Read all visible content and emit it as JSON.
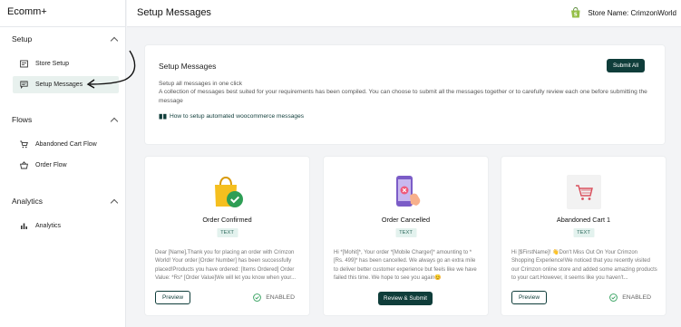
{
  "app": {
    "brand": "Ecomm+"
  },
  "header": {
    "title": "Setup Messages",
    "store_label": "Store Name: CrimzonWorld"
  },
  "sidebar": {
    "sections": [
      {
        "title": "Setup",
        "items": [
          {
            "label": "Store Setup",
            "icon": "store-icon"
          },
          {
            "label": "Setup Messages",
            "icon": "message-icon",
            "active": true
          }
        ]
      },
      {
        "title": "Flows",
        "items": [
          {
            "label": "Abandoned Cart Flow",
            "icon": "cart-icon"
          },
          {
            "label": "Order Flow",
            "icon": "basket-icon"
          }
        ]
      },
      {
        "title": "Analytics",
        "items": [
          {
            "label": "Analytics",
            "icon": "bar-chart-icon"
          }
        ]
      }
    ]
  },
  "setup": {
    "title": "Setup Messages",
    "submit_all": "Submit All",
    "desc_line1": "Setup all messages in one click",
    "desc_line2": "A collection of messages best suited for your requirements has been compiled. You can choose to submit all the messages together or to carefully review each one before submitting the message",
    "howto": "How to setup automated woocommerce messages"
  },
  "messages": [
    {
      "title": "Order Confirmed",
      "tag": "TEXT",
      "body": "Dear [Name],Thank you for placing an order with Crimzon World! Your order [Order Number] has been successfully placed!Products you have ordered: [Items Ordered] Order Value: *Rs* [Order Value]We will let you know when your...",
      "preview": "Preview",
      "status": "ENABLED"
    },
    {
      "title": "Order Cancelled",
      "tag": "TEXT",
      "body": "Hi *[Mohit]*, Your order *[Mobile Charger]* amounting to *[Rs. 499]* has been cancelled. We always go an extra mile to deliver better customer experience but feels like we have failed this time. We hope to see you again😊",
      "review": "Review & Submit"
    },
    {
      "title": "Abandoned Cart 1",
      "tag": "TEXT",
      "body": "Hi [$FirstName]! 👋Don't Miss Out On Your Crimzon Shopping Experience!We noticed that you recently visited our Crimzon online store and added some amazing products to your cart.However, it seems like you haven't...",
      "preview": "Preview",
      "status": "ENABLED"
    }
  ],
  "colors": {
    "primary": "#0f3d3a",
    "tag_bg": "#e3f2ee",
    "enabled_green": "#2f9e5a",
    "shopify_green": "#95bf47"
  }
}
